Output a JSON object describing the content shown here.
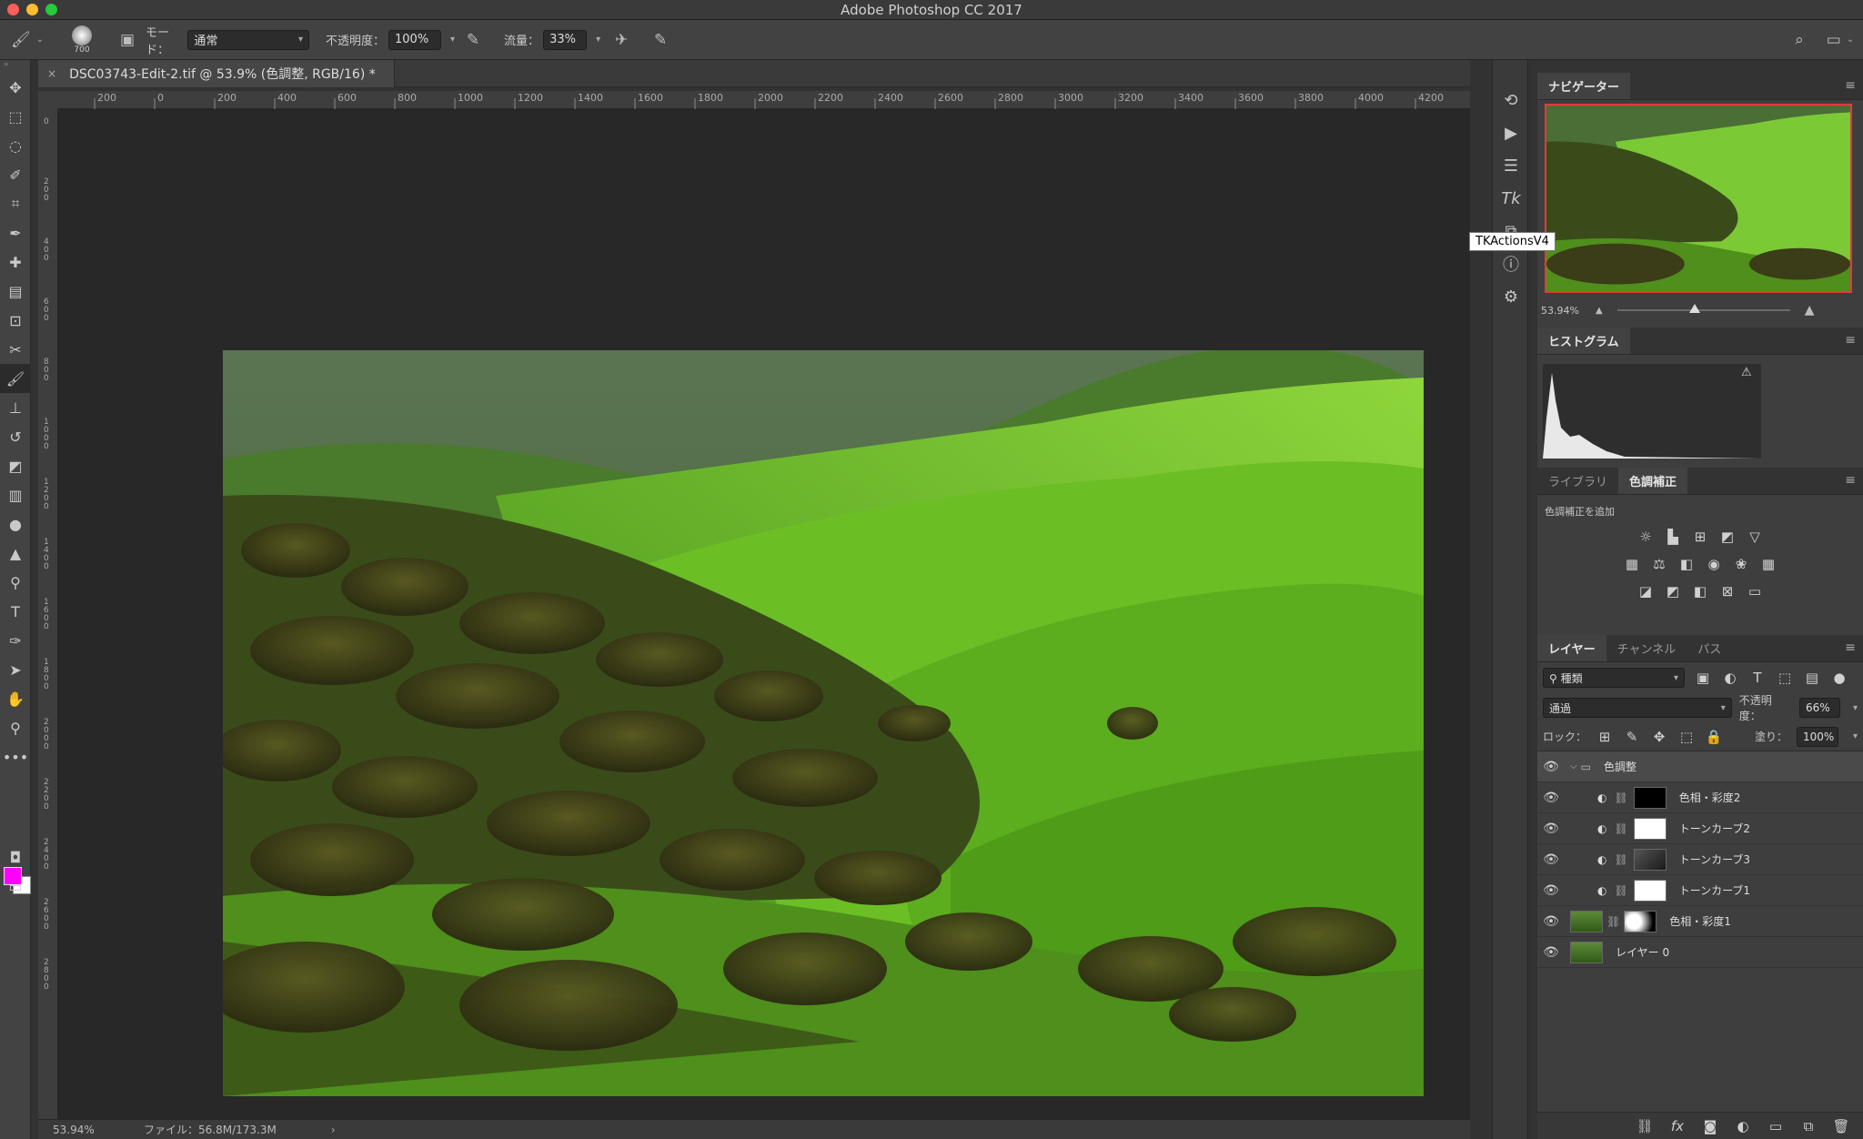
{
  "window": {
    "title": "Adobe Photoshop CC 2017"
  },
  "options_bar": {
    "brush_size": "700",
    "mode_label": "モード：",
    "mode_value": "通常",
    "opacity_label": "不透明度：",
    "opacity_value": "100%",
    "flow_label": "流量：",
    "flow_value": "33%"
  },
  "document": {
    "tab_title": "DSC03743-Edit-2.tif @ 53.9% (色調整, RGB/16) *",
    "ruler_ticks": [
      "200",
      "0",
      "200",
      "400",
      "600",
      "800",
      "1000",
      "1200",
      "1400",
      "1600",
      "1800",
      "2000",
      "2200",
      "2400",
      "2600",
      "2800",
      "3000",
      "3200",
      "3400",
      "3600",
      "3800",
      "4000",
      "4200"
    ],
    "vruler_ticks": [
      "0",
      "2\n0\n0",
      "4\n0\n0",
      "6\n0\n0",
      "8\n0\n0",
      "1\n0\n0\n0",
      "1\n2\n0\n0",
      "1\n4\n0\n0",
      "1\n6\n0\n0",
      "1\n8\n0\n0",
      "2\n0\n0\n0",
      "2\n2\n0\n0",
      "2\n4\n0\n0",
      "2\n6\n0\n0",
      "2\n8\n0\n0"
    ]
  },
  "status": {
    "zoom": "53.94%",
    "file_info": "ファイル：56.8M/173.3M",
    "arrow": "›"
  },
  "tooltip": "TKActionsV4",
  "navigator": {
    "tab": "ナビゲーター",
    "zoom": "53.94%",
    "slider_fraction": 0.45
  },
  "histogram": {
    "tab": "ヒストグラム"
  },
  "adjustments": {
    "tabs": [
      "ライブラリ",
      "色調補正"
    ],
    "header": "色調補正を追加"
  },
  "layers_panel": {
    "tabs": [
      "レイヤー",
      "チャンネル",
      "パス"
    ],
    "filter_label": "種類",
    "blend_mode": "通過",
    "opacity_label": "不透明度：",
    "opacity_value": "66%",
    "lock_label": "ロック：",
    "fill_label": "塗り：",
    "fill_value": "100%",
    "layers": [
      {
        "name": "色調整",
        "kind": "group"
      },
      {
        "name": "色相・彩度2",
        "kind": "adj",
        "mask": "black"
      },
      {
        "name": "トーンカーブ2",
        "kind": "adj",
        "mask": "white"
      },
      {
        "name": "トーンカーブ3",
        "kind": "adj",
        "mask": "dark"
      },
      {
        "name": "トーンカーブ1",
        "kind": "adj",
        "mask": "white"
      },
      {
        "name": "色相・彩度1",
        "kind": "pixel-mask"
      },
      {
        "name": "レイヤー 0",
        "kind": "pixel"
      }
    ]
  },
  "colors": {
    "foreground": "#ff00ff",
    "background": "#ffffff",
    "accent_green": "#5aa82a"
  }
}
